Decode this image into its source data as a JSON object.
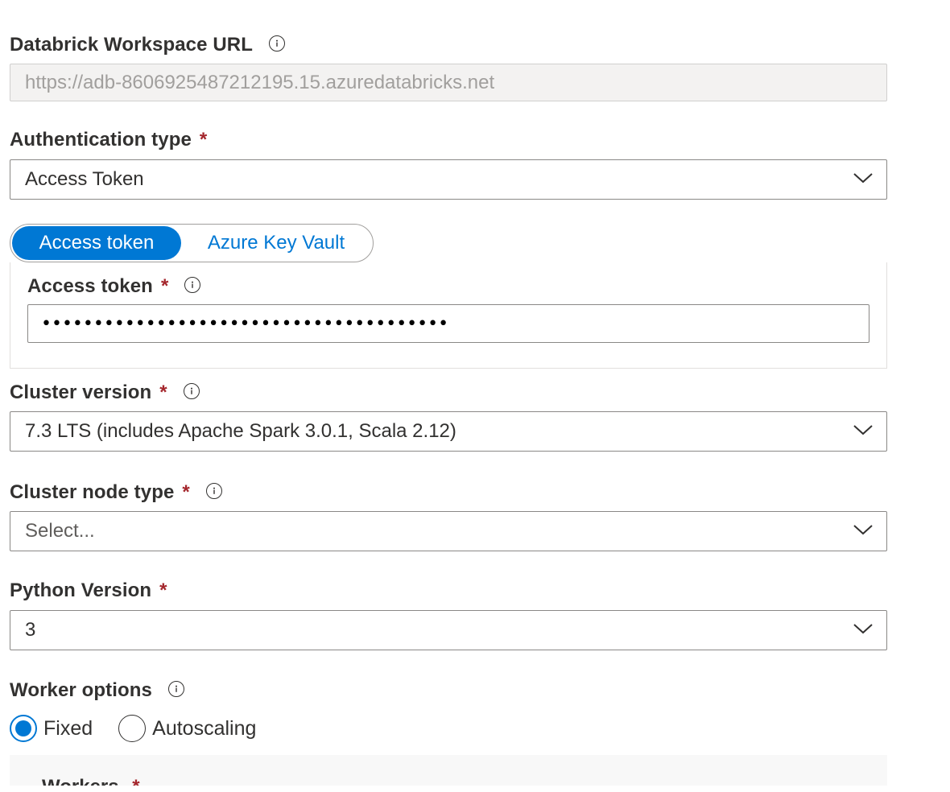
{
  "workspace_url": {
    "label": "Databrick Workspace URL",
    "value": "https://adb-8606925487212195.15.azuredatabricks.net"
  },
  "auth_type": {
    "label": "Authentication type",
    "required_mark": "*",
    "value": "Access Token"
  },
  "credential_toggle": {
    "options": [
      "Access token",
      "Azure Key Vault"
    ],
    "selected": "Access token"
  },
  "access_token": {
    "label": "Access token",
    "required_mark": "*",
    "masked_value": "•••••••••••••••••••••••••••••••••••••••"
  },
  "cluster_version": {
    "label": "Cluster version",
    "required_mark": "*",
    "value": "7.3 LTS (includes Apache Spark 3.0.1, Scala 2.12)"
  },
  "cluster_node_type": {
    "label": "Cluster node type",
    "required_mark": "*",
    "placeholder": "Select..."
  },
  "python_version": {
    "label": "Python Version",
    "required_mark": "*",
    "value": "3"
  },
  "worker_options": {
    "label": "Worker options",
    "options": [
      "Fixed",
      "Autoscaling"
    ],
    "selected": "Fixed"
  },
  "workers": {
    "label": "Workers",
    "required_mark": "*"
  },
  "colors": {
    "accent": "#0078d4",
    "required": "#a4262c",
    "text": "#323130",
    "border": "#8a8886"
  },
  "icons": {
    "info": "info-icon",
    "dropdown": "chevron-down-icon"
  }
}
